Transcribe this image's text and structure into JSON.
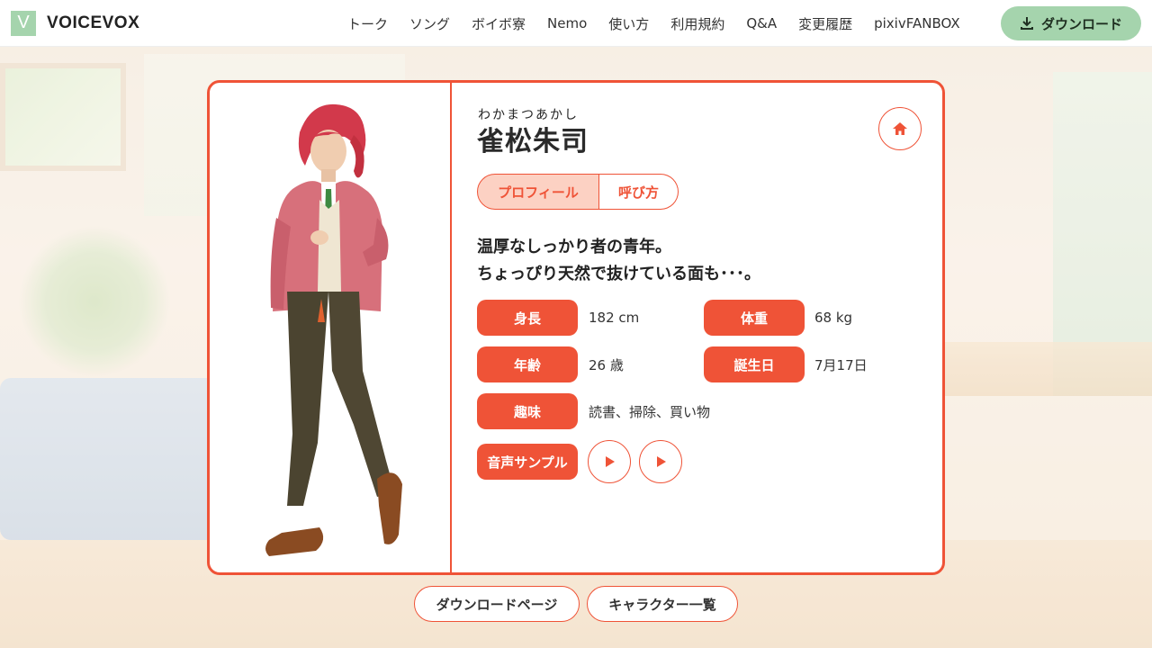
{
  "header": {
    "logo_letter": "V",
    "logo_text": "VOICEVOX",
    "nav": [
      "トーク",
      "ソング",
      "ボイボ寮",
      "Nemo",
      "使い方",
      "利用規約",
      "Q&A",
      "変更履歴",
      "pixivFANBOX"
    ],
    "download_label": "ダウンロード"
  },
  "character": {
    "ruby": "わかまつあかし",
    "name": "雀松朱司",
    "tabs": [
      "プロフィール",
      "呼び方"
    ],
    "description_line1": "温厚なしっかり者の青年。",
    "description_line2": "ちょっぴり天然で抜けている面も･･･。",
    "fields": {
      "height_label": "身長",
      "height_value": "182 cm",
      "weight_label": "体重",
      "weight_value": "68 kg",
      "age_label": "年齢",
      "age_value": "26 歳",
      "birthday_label": "誕生日",
      "birthday_value": "7月17日",
      "hobby_label": "趣味",
      "hobby_value": "読書、掃除、買い物",
      "sample_label": "音声サンプル"
    }
  },
  "footer": {
    "download_page": "ダウンロードページ",
    "character_list": "キャラクター一覧"
  },
  "colors": {
    "accent": "#ef5337",
    "accent_light": "#fcd1c3",
    "brand_green": "#a5d4ad"
  },
  "icons": [
    "download-icon",
    "home-icon",
    "play-icon"
  ]
}
